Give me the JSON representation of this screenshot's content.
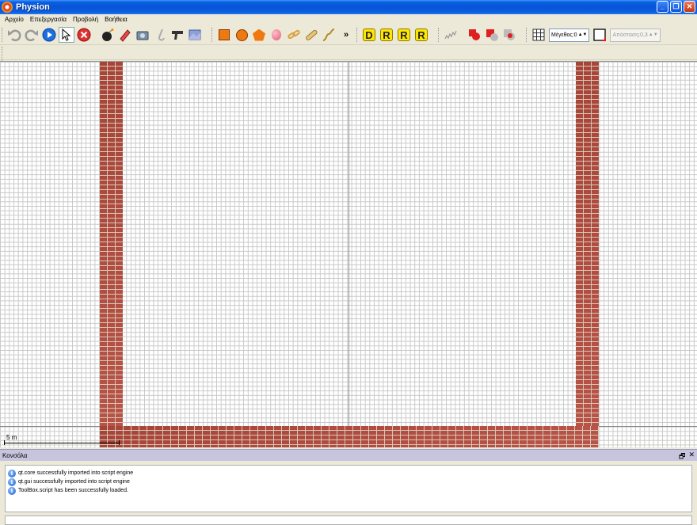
{
  "window": {
    "title": "Physion"
  },
  "menu": {
    "items": [
      "Αρχείο",
      "Επεξεργασία",
      "Προβολή",
      "Βοήθεια"
    ]
  },
  "toolbar": {
    "overflow_glyph": "»",
    "dynamic_letters": [
      "D",
      "R",
      "R",
      "R"
    ],
    "size_spinner": {
      "label": "Μέγεθος:0",
      "arrows": "▲▼"
    },
    "distance_spinner": {
      "label": "Απόσταση:0,3",
      "arrows": "▲▼"
    }
  },
  "canvas": {
    "scale_label": "5 m"
  },
  "console": {
    "title": "Κονσόλα",
    "float_glyph": "🗗",
    "close_glyph": "✕",
    "info_glyph": "i",
    "messages": [
      "qt.core successfully imported into script engine",
      "qt.gui successfully imported into script engine",
      "ToolBox.script has been successfully loaded."
    ]
  },
  "colors": {
    "brick": "#b44a3c",
    "shape_orange": "#f07810",
    "title_blue": "#0854d6"
  }
}
